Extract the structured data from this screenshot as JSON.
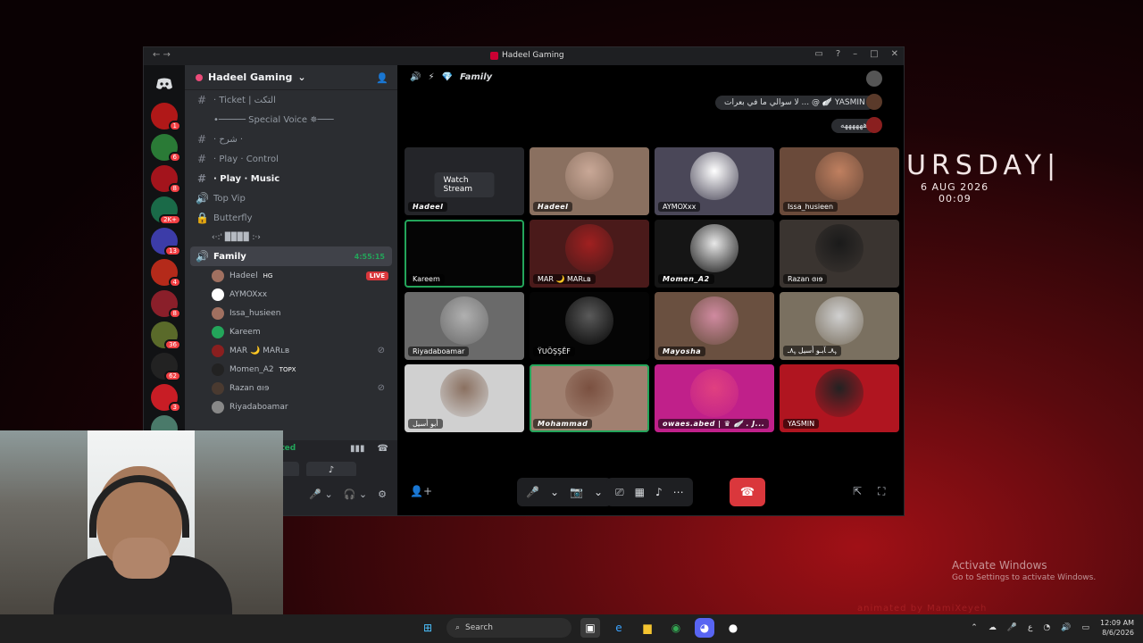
{
  "desktop": {
    "clock_day": "URSDAY|",
    "clock_date": "6 AUG 2026",
    "clock_time": "00:09",
    "activate_title": "Activate Windows",
    "activate_sub": "Go to Settings to activate Windows.",
    "watermark": "animated by MamiXeyeh"
  },
  "window": {
    "title": "Hadeel Gaming",
    "accent": "#23a55a"
  },
  "guilds": [
    {
      "color": "#b01818",
      "badge": "1"
    },
    {
      "color": "#2a7a36",
      "badge": "6"
    },
    {
      "color": "#a3141c",
      "badge": "8"
    },
    {
      "color": "#1a6a48",
      "badge": "2K+"
    },
    {
      "color": "#3c3ca8",
      "badge": "13"
    },
    {
      "color": "#b42a1a",
      "badge": "4"
    },
    {
      "color": "#8a1f2a",
      "badge": "8"
    },
    {
      "color": "#5a6a2a",
      "badge": "36"
    },
    {
      "color": "#222",
      "badge": "62"
    },
    {
      "color": "#c81d25",
      "badge": "3"
    },
    {
      "color": "#4a7a6a",
      "badge": "4"
    }
  ],
  "server": {
    "name": "Hadeel Gaming",
    "channels": [
      {
        "sym": "#",
        "label": "· Ticket | التكت",
        "bold": false
      },
      {
        "sym": "",
        "label": "•───── Special Voice ✵───",
        "bold": false
      },
      {
        "sym": "#",
        "label": "· شرح ·",
        "bold": false
      },
      {
        "sym": "#",
        "label": "· Play · Control",
        "bold": false
      },
      {
        "sym": "#",
        "label": "· Play · Music",
        "bold": true
      },
      {
        "sym": "🔊",
        "label": "Top Vip",
        "bold": false
      },
      {
        "sym": "🔒",
        "label": "Butterfly",
        "bold": false
      }
    ],
    "channel_extra": "‹·:' ▉▉▉▉ :·›",
    "active_channel": {
      "label": "Family",
      "duration": "4:55:15"
    },
    "members": [
      {
        "name": "Hadeel",
        "tag": "HG",
        "live": "LIVE",
        "color": "#a07060"
      },
      {
        "name": "AYMOXxx",
        "color": "#ffffff"
      },
      {
        "name": "Issa_husieen",
        "color": "#a07060"
      },
      {
        "name": "Kareem",
        "color": "#23a55a"
      },
      {
        "name": "MAR 🌙 MARʟʙ",
        "color": "#8a1f1f",
        "muted": true
      },
      {
        "name": "Momen_A2",
        "tag": "TOPX",
        "color": "#222222"
      },
      {
        "name": "Razan ɞıɘ",
        "color": "#4a3a30",
        "muted": true
      },
      {
        "name": "Riyadaboamar",
        "color": "#888"
      }
    ],
    "voice_status": "Voice Connected"
  },
  "stage": {
    "channel_name": "Family",
    "chat": [
      {
        "text": "لا سوالي ما في بعرات ... @ 🪽 YASMIN"
      },
      {
        "text": "ههههههه"
      }
    ],
    "tiles": [
      {
        "label": "Hadeel",
        "fancy": true,
        "bg": "#242529",
        "watch": "Watch Stream"
      },
      {
        "label": "Hadeel",
        "fancy": true,
        "bg": "#8a7060",
        "av": "#c9a897"
      },
      {
        "label": "AYMOXxx",
        "bg": "#4a4758",
        "av": "#ffffff"
      },
      {
        "label": "Issa_husieen",
        "bg": "#6a4a3a",
        "av": "#c08060"
      },
      {
        "label": "Kareem",
        "bg": "#050505",
        "speaking": true
      },
      {
        "label": "MAR 🌙 MARʟʙ",
        "bg": "#4a1a1a",
        "av": "#a02020"
      },
      {
        "label": "Momen_A2",
        "fancy": true,
        "bg": "#151515",
        "av": "#e8e8e8"
      },
      {
        "label": "Razan ɞıɘ",
        "bg": "#3a3430",
        "av": "#1a1a1a"
      },
      {
        "label": "Riyadaboamar",
        "bg": "#6a6a6a",
        "av": "#b0b0b0"
      },
      {
        "label": "ŸUÖŞŞĔF",
        "bg": "#050505",
        "av": "#5a5a5a"
      },
      {
        "label": "Mayosha",
        "fancy": true,
        "bg": "#6a5040",
        "av": "#d08aa0"
      },
      {
        "label": "ﮩ٨ـ ﺂبـو أسيل ﮩ٨ـ",
        "bg": "#7a7060",
        "av": "#d0d0d0"
      },
      {
        "label": "أبو أسيل",
        "bg": "#d0d0d0",
        "av": "#8a7060"
      },
      {
        "label": "Mohammad",
        "fancy": true,
        "bg": "#a08070",
        "av": "#7a5040",
        "speaking": true
      },
      {
        "label": "owaes.abed | ♛ 🪽 . J...",
        "fancy": true,
        "bg": "#c0208a",
        "av": "#e04080"
      },
      {
        "label": "YASMIN",
        "bg": "#b01520",
        "av": "#222222"
      }
    ]
  },
  "taskbar": {
    "search_placeholder": "Search",
    "time": "12:09 AM",
    "date": "8/6/2026"
  }
}
